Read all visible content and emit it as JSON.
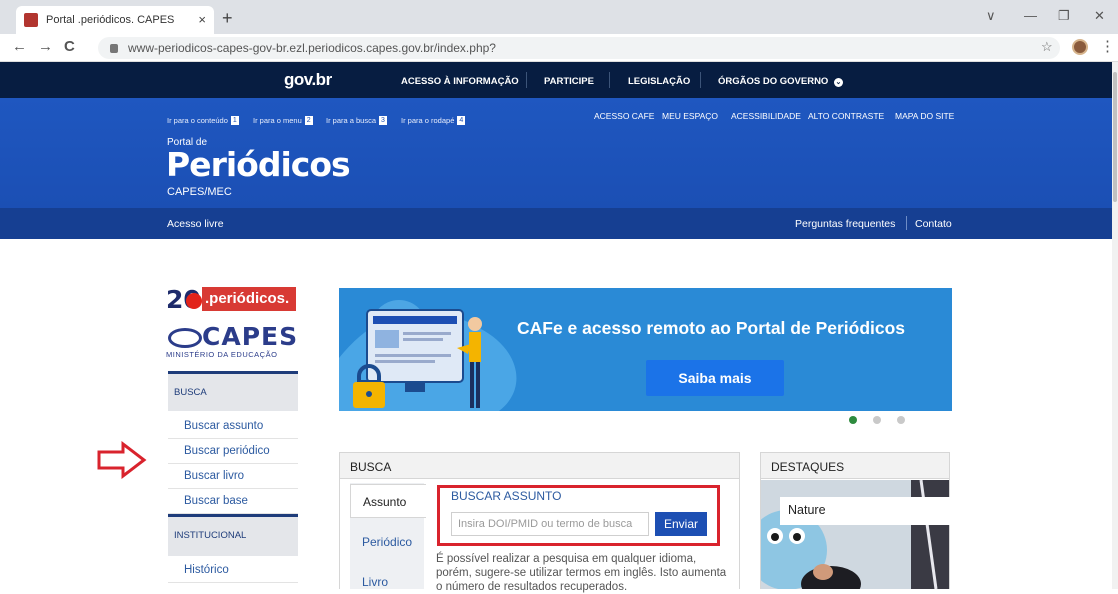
{
  "browser": {
    "tab_title": "Portal .periódicos. CAPES",
    "tab_close": "×",
    "new_tab": "+",
    "url": "www-periodicos-capes-gov-br.ezl.periodicos.capes.gov.br/index.php?",
    "back": "←",
    "forward": "→",
    "reload": "C",
    "star": "☆",
    "menu": "⋮",
    "minimize": "—",
    "restore": "❐",
    "close": "✕",
    "tab_list": "∨"
  },
  "gov": {
    "logo": "gov.br",
    "links": [
      "ACESSO À INFORMAÇÃO",
      "PARTICIPE",
      "LEGISLAÇÃO",
      "ÓRGÃOS DO GOVERNO"
    ]
  },
  "header": {
    "accessibility_links": [
      {
        "label": "Ir para o conteúdo",
        "num": "1"
      },
      {
        "label": "Ir para o menu",
        "num": "2"
      },
      {
        "label": "Ir para a busca",
        "num": "3"
      },
      {
        "label": "Ir para o rodapé",
        "num": "4"
      }
    ],
    "top_links": [
      "ACESSO CAFE",
      "MEU ESPAÇO",
      "ACESSIBILIDADE",
      "ALTO CONTRASTE",
      "MAPA DO SITE"
    ],
    "portal_de": "Portal de",
    "title": "Periódicos",
    "subtitle": "CAPES/MEC"
  },
  "subnav": {
    "left": "Acesso livre",
    "faq": "Perguntas frequentes",
    "contact": "Contato"
  },
  "logos": {
    "twenty": "20",
    "periodicos": ".periódicos.",
    "capes": "CAPES",
    "ministerio": "MINISTÉRIO DA EDUCAÇÃO"
  },
  "left_menu": {
    "busca_head": "BUSCA",
    "busca_items": [
      "Buscar assunto",
      "Buscar periódico",
      "Buscar livro",
      "Buscar base"
    ],
    "institucional_head": "INSTITUCIONAL",
    "institucional_items": [
      "Histórico"
    ]
  },
  "banner": {
    "title": "CAFe e acesso remoto ao Portal de Periódicos",
    "button": "Saiba mais"
  },
  "busca_panel": {
    "header": "BUSCA",
    "tabs": [
      "Assunto",
      "Periódico",
      "Livro"
    ],
    "section_title": "BUSCAR ASSUNTO",
    "input_placeholder": "Insira DOI/PMID ou termo de busca",
    "submit": "Enviar",
    "help": "É possível realizar a pesquisa em qualquer idioma, porém, sugere-se utilizar termos em inglês. Isto aumenta o número de resultados recuperados."
  },
  "destaques": {
    "header": "DESTAQUES",
    "item": "Nature"
  }
}
